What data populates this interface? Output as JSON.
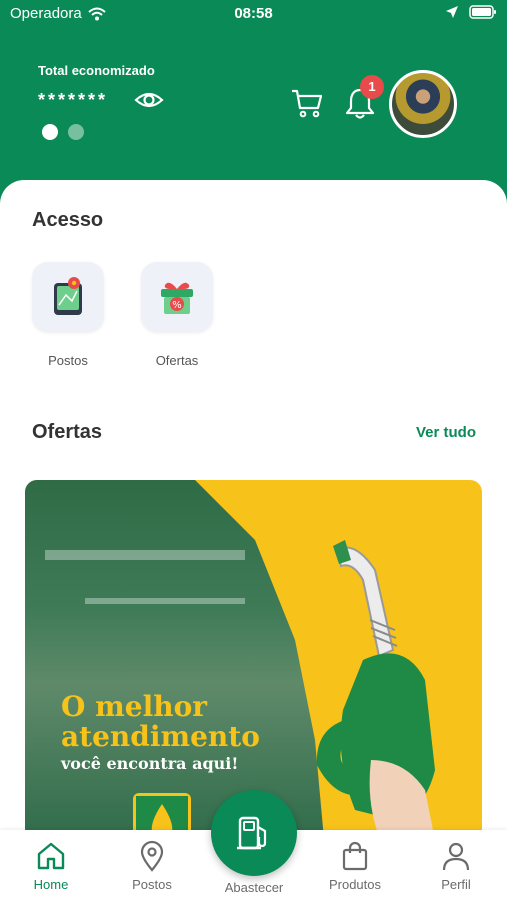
{
  "status_bar": {
    "carrier": "Operadora",
    "time": "08:58"
  },
  "header": {
    "saved_label": "Total economizado",
    "saved_value_masked": "*******",
    "notification_count": "1",
    "colors": {
      "brand_green": "#0a8a57",
      "badge_red": "#e94b4b"
    }
  },
  "access": {
    "title": "Acesso",
    "items": [
      {
        "label": "Postos",
        "icon": "map-phone-icon"
      },
      {
        "label": "Ofertas",
        "icon": "gift-icon"
      }
    ]
  },
  "offers": {
    "title": "Ofertas",
    "see_all": "Ver tudo",
    "banner": {
      "line1": "O melhor",
      "line2": "atendimento",
      "line3": "você encontra aqui!",
      "accent_color": "#f7c21a"
    }
  },
  "tabbar": {
    "items": [
      {
        "label": "Home",
        "icon": "home-icon",
        "active": true
      },
      {
        "label": "Postos",
        "icon": "location-pin-icon",
        "active": false
      },
      {
        "label": "Abastecer",
        "icon": "fuel-pump-icon",
        "active": false
      },
      {
        "label": "Produtos",
        "icon": "shopping-bag-icon",
        "active": false
      },
      {
        "label": "Perfil",
        "icon": "user-icon",
        "active": false
      }
    ]
  }
}
